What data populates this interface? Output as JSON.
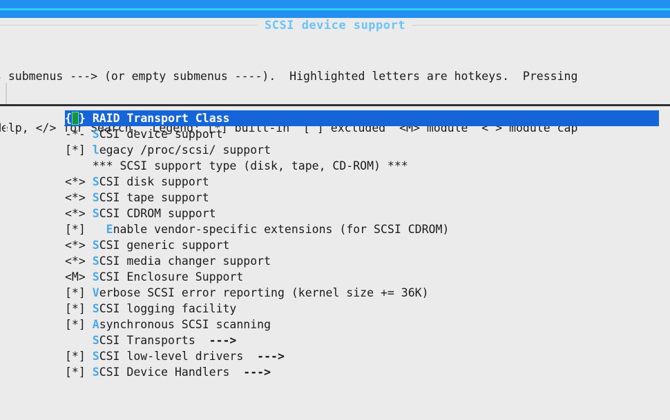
{
  "window": {
    "titlebar_color": "#2390f1",
    "titlebar_accent_color": "#2ad2f5"
  },
  "dialog": {
    "title": "SCSI device support",
    "title_color": "#6cc3f7",
    "background": "#ebebeb"
  },
  "help": {
    "line1": "s submenus ---> (or empty submenus ----).  Highlighted letters are hotkeys.  Pressing",
    "line2": "Help, </> for Search.  Legend: [*] built-in  [ ] excluded  <M> module  < > module cap"
  },
  "legend": {
    "built_in": "[*] built-in",
    "excluded": "[ ] excluded",
    "module": "<M> module",
    "module_capable": "< > module cap"
  },
  "menu": {
    "selected_index": 0,
    "selected_bg": "#1565d8",
    "hotkey_color": "#4aa8e8",
    "selected_hotkey_color": "#f2e54c",
    "items": [
      {
        "marker": "{ }",
        "hotkey": "",
        "label": "RAID Transport Class",
        "arrow": "",
        "indent": "",
        "selected": true,
        "cursor": true
      },
      {
        "marker": "-*-",
        "hotkey": "S",
        "label": "CSI device support",
        "arrow": "",
        "indent": "",
        "selected": false,
        "cursor": false
      },
      {
        "marker": "[*]",
        "hotkey": "l",
        "label": "egacy /proc/scsi/ support",
        "arrow": "",
        "indent": "",
        "selected": false,
        "cursor": false
      },
      {
        "marker": "   ",
        "hotkey": "",
        "label": "*** SCSI support type (disk, tape, CD-ROM) ***",
        "arrow": "",
        "indent": "",
        "selected": false,
        "cursor": false
      },
      {
        "marker": "<*>",
        "hotkey": "S",
        "label": "CSI disk support",
        "arrow": "",
        "indent": "",
        "selected": false,
        "cursor": false
      },
      {
        "marker": "<*>",
        "hotkey": "S",
        "label": "CSI tape support",
        "arrow": "",
        "indent": "",
        "selected": false,
        "cursor": false
      },
      {
        "marker": "<*>",
        "hotkey": "S",
        "label": "CSI CDROM support",
        "arrow": "",
        "indent": "",
        "selected": false,
        "cursor": false
      },
      {
        "marker": "[*]",
        "hotkey": "E",
        "label": "nable vendor-specific extensions (for SCSI CDROM)",
        "arrow": "",
        "indent": "  ",
        "selected": false,
        "cursor": false
      },
      {
        "marker": "<*>",
        "hotkey": "S",
        "label": "CSI generic support",
        "arrow": "",
        "indent": "",
        "selected": false,
        "cursor": false
      },
      {
        "marker": "<*>",
        "hotkey": "S",
        "label": "CSI media changer support",
        "arrow": "",
        "indent": "",
        "selected": false,
        "cursor": false
      },
      {
        "marker": "<M>",
        "hotkey": "S",
        "label": "CSI Enclosure Support",
        "arrow": "",
        "indent": "",
        "selected": false,
        "cursor": false
      },
      {
        "marker": "[*]",
        "hotkey": "V",
        "label": "erbose SCSI error reporting (kernel size += 36K)",
        "arrow": "",
        "indent": "",
        "selected": false,
        "cursor": false
      },
      {
        "marker": "[*]",
        "hotkey": "S",
        "label": "CSI logging facility",
        "arrow": "",
        "indent": "",
        "selected": false,
        "cursor": false
      },
      {
        "marker": "[*]",
        "hotkey": "A",
        "label": "synchronous SCSI scanning",
        "arrow": "",
        "indent": "",
        "selected": false,
        "cursor": false
      },
      {
        "marker": "   ",
        "hotkey": "S",
        "label": "CSI Transports",
        "arrow": "  --->",
        "indent": "",
        "selected": false,
        "cursor": false
      },
      {
        "marker": "[*]",
        "hotkey": "S",
        "label": "CSI low-level drivers",
        "arrow": "  --->",
        "indent": "",
        "selected": false,
        "cursor": false
      },
      {
        "marker": "[*]",
        "hotkey": "S",
        "label": "CSI Device Handlers",
        "arrow": "  --->",
        "indent": "",
        "selected": false,
        "cursor": false
      }
    ]
  }
}
